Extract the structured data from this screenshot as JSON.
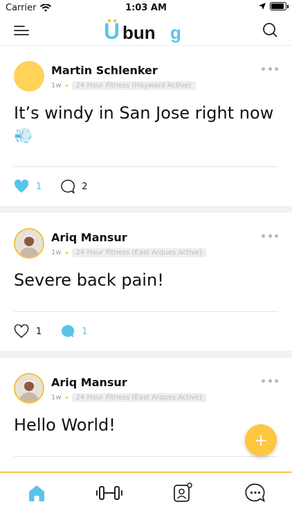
{
  "status_bar": {
    "carrier": "Carrier",
    "time": "1:03 AM"
  },
  "header": {
    "logo_text": "Ubung",
    "logo_colors": {
      "primary": "#59c5e8",
      "secondary": "#111111",
      "accent": "#f1c13b"
    }
  },
  "posts": [
    {
      "author": "Martin Schlenker",
      "time": "1w",
      "gym": "24 Hour Fitness (Hayward Active)",
      "text": "It’s windy in San Jose right now",
      "emoji": "💨",
      "likes": "1",
      "comments": "2",
      "liked": true,
      "commented": false
    },
    {
      "author": "Ariq Mansur",
      "time": "1w",
      "gym": "24 Hour Fitness (East Arques Active)",
      "text": "Severe back pain!",
      "likes": "1",
      "comments": "1",
      "liked": false,
      "commented": true
    },
    {
      "author": "Ariq Mansur",
      "time": "1w",
      "gym": "24 Hour Fitness (East Arques Active)",
      "text": "Hello World!"
    }
  ],
  "fab": {
    "label": "+"
  },
  "bottom_nav": [
    "home",
    "workout",
    "profile",
    "chat"
  ],
  "colors": {
    "accent_yellow": "#ffc640",
    "accent_blue": "#59c5e8"
  }
}
